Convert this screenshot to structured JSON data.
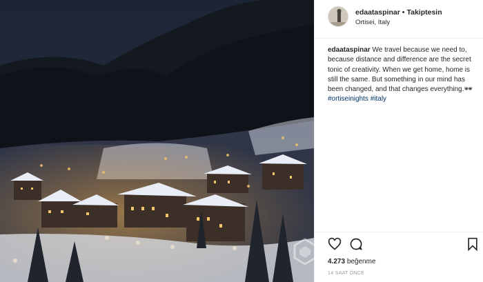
{
  "post": {
    "username": "edaataspinar",
    "separator": "•",
    "follow_label": "Takiptesin",
    "location": "Ortisei, Italy",
    "caption_text": "We travel because we need to, because distance and difference are the secret tonic of creativity. When we get home, home is still the same. But something in our mind has been changed, and that changes everything.",
    "caption_emoji": "🕶",
    "hashtags": [
      "#ortiseinights",
      "#italy"
    ],
    "likes_count": "4.273",
    "likes_label": "beğenme",
    "time_ago": "14 SAAT ÖNCE"
  },
  "icons": {
    "like": "heart-icon",
    "comment": "comment-icon",
    "save": "bookmark-icon"
  },
  "colors": {
    "text": "#262626",
    "hashtag": "#003569",
    "muted": "#999999",
    "divider": "#efefef"
  }
}
